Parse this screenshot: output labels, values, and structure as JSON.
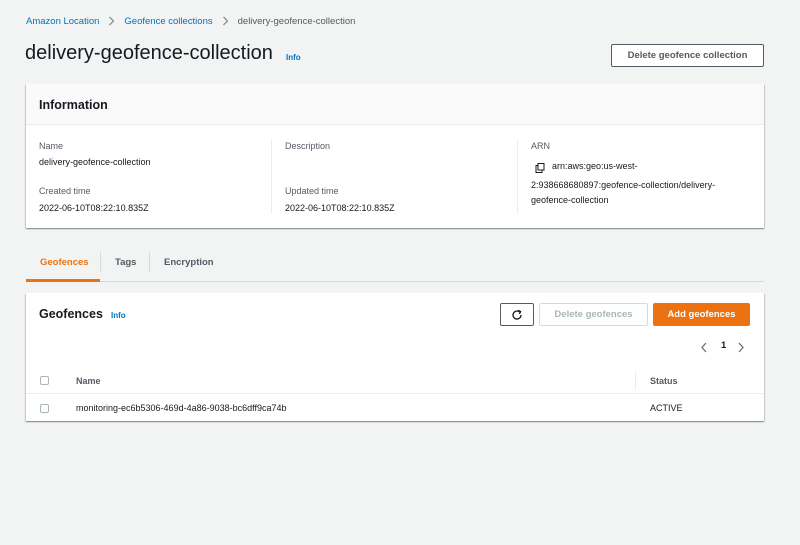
{
  "breadcrumb": {
    "items": [
      "Amazon Location",
      "Geofence collections"
    ],
    "current": "delivery-geofence-collection"
  },
  "header": {
    "title": "delivery-geofence-collection",
    "info_label": "Info",
    "delete_collection_label": "Delete geofence collection"
  },
  "information": {
    "heading": "Information",
    "name_label": "Name",
    "name_value": "delivery-geofence-collection",
    "created_label": "Created time",
    "created_value": "2022-06-10T08:22:10.835Z",
    "description_label": "Description",
    "updated_label": "Updated time",
    "updated_value": "2022-06-10T08:22:10.835Z",
    "arn_label": "ARN",
    "arn_lines": [
      "arn:aws:geo:us-west-",
      "2:938668680897:geofence-collection/delivery-",
      "geofence-collection"
    ],
    "copy_icon": "copy-icon"
  },
  "tabs": {
    "items": [
      "Geofences",
      "Tags",
      "Encryption"
    ],
    "active": "Geofences"
  },
  "geofences": {
    "heading": "Geofences",
    "info_label": "Info",
    "refresh_icon": "refresh-icon",
    "delete_label": "Delete geofences",
    "add_label": "Add geofences",
    "pagination": {
      "current_page": "1"
    },
    "columns": [
      "Name",
      "Status"
    ],
    "rows": [
      {
        "name": "monitoring-ec6b5306-469d-4a86-9038-bc6dff9ca74b",
        "status": "ACTIVE"
      }
    ]
  },
  "colors": {
    "link": "#0073bb",
    "primary": "#ec7211",
    "background": "#f2f3f3"
  }
}
